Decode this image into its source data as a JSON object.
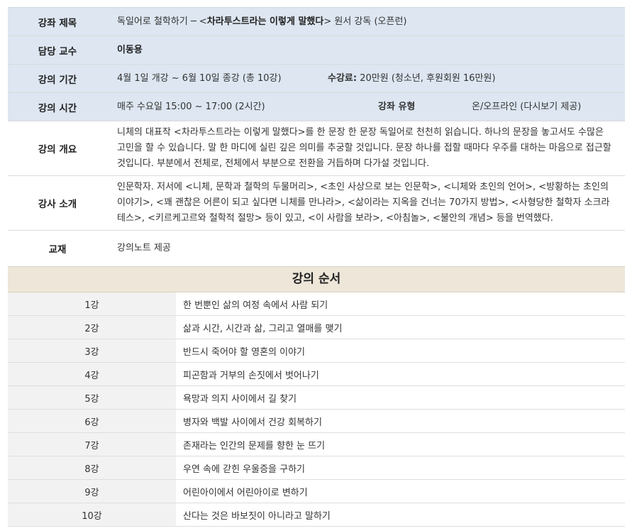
{
  "info": {
    "title_label": "강좌 제목",
    "title_prefix": "독일어로 철학하기 ─ <",
    "title_book": "차라투스트라는 이렇게 말했다",
    "title_suffix": "> 원서 강독 (오픈런)",
    "prof_label": "담당 교수",
    "prof_value": "이동용",
    "period_label": "강의 기간",
    "period_value": "4월 1일 개강 ~ 6월 10일 종강 (총 10강)",
    "fee_label": "수강료:",
    "fee_value": " 20만원 (청소년, 후원회원 16만원)",
    "time_label": "강의 시간",
    "time_value": "매주 수요일 15:00 ~ 17:00 (2시간)",
    "type_label": "강좌 유형",
    "type_value": "온/오프라인 (다시보기 제공)",
    "overview_label": "강의 개요",
    "overview_value": "니체의 대표작 <차라투스트라는 이렇게 말했다>를 한 문장 한 문장 독일어로 천천히 읽습니다. 하나의 문장을 놓고서도 수많은 고민을 할 수 있습니다. 말 한 마디에 실린 깊은 의미를 추궁할 것입니다. 문장 하나를 접할 때마다 우주를 대하는 마음으로 접근할 것입니다. 부분에서 전체로, 전체에서 부분으로 전환을 거듭하며 다가설 것입니다.",
    "instructor_label": "강사 소개",
    "instructor_value": "인문학자. 저서에 <니체, 문학과 철학의 두물머리>, <초인 사상으로 보는 인문학>, <니체와 초인의 언어>, <방황하는 초인의 이야기>, <꽤 괜찮은 어른이 되고 싶다면 니체를 만나라>, <삶이라는 지옥을 건너는 70가지 방법>, <사형당한 철학자 소크라테스>, <키르케고르와 철학적 절망> 등이 있고, <이 사람을 보라>, <아침놀>, <불안의 개념> 등을 번역했다.",
    "textbook_label": "교재",
    "textbook_value": "강의노트 제공"
  },
  "schedule": {
    "title": "강의 순서",
    "rows": [
      {
        "num": "1강",
        "title": "한 번뿐인 삶의 여정 속에서 사람 되기"
      },
      {
        "num": "2강",
        "title": "삶과 시간, 시간과 삶, 그리고 열매를 맺기"
      },
      {
        "num": "3강",
        "title": "반드시 죽어야 할 영혼의 이야기"
      },
      {
        "num": "4강",
        "title": "피곤함과 거부의 손짓에서 벗어나기"
      },
      {
        "num": "5강",
        "title": "욕망과 의지 사이에서 길 찾기"
      },
      {
        "num": "6강",
        "title": "병자와 백발 사이에서 건강 회복하기"
      },
      {
        "num": "7강",
        "title": "존재라는 인간의 문제를 향한 눈 뜨기"
      },
      {
        "num": "8강",
        "title": "우연 속에 갇힌 우울증을 구하기"
      },
      {
        "num": "9강",
        "title": "어린아이에서 어린아이로 변하기"
      },
      {
        "num": "10강",
        "title": "산다는 것은 바보짓이 아니라고 말하기"
      }
    ]
  },
  "colors": {
    "info_shade": "#dde6f1",
    "schedule_header": "#ede6d9",
    "schedule_num_bg": "#f2f2f2"
  }
}
